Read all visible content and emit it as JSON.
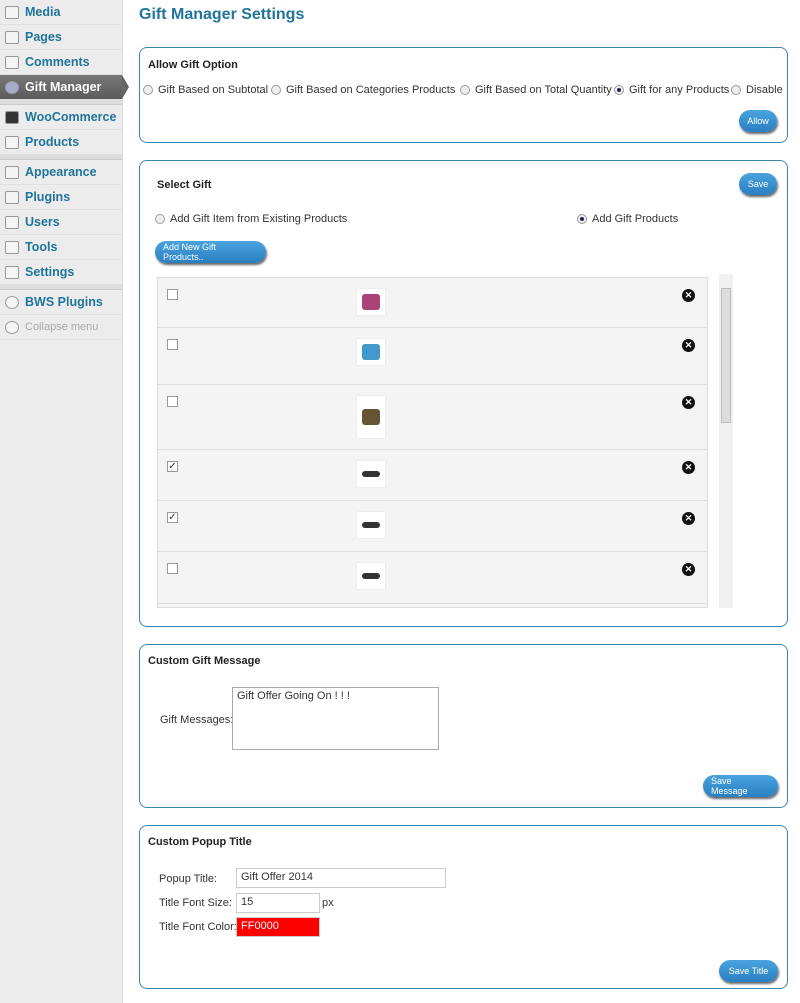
{
  "sidebar": {
    "items": [
      {
        "label": "Media",
        "icon": "media-icon"
      },
      {
        "label": "Pages",
        "icon": "pages-icon"
      },
      {
        "label": "Comments",
        "icon": "comments-icon"
      },
      {
        "label": "Gift Manager",
        "icon": "gear-icon",
        "active": true
      },
      {
        "label": "WooCommerce",
        "icon": "woocommerce-icon"
      },
      {
        "label": "Products",
        "icon": "cart-icon"
      },
      {
        "label": "Appearance",
        "icon": "appearance-icon"
      },
      {
        "label": "Plugins",
        "icon": "plugin-icon"
      },
      {
        "label": "Users",
        "icon": "users-icon"
      },
      {
        "label": "Tools",
        "icon": "tools-icon"
      },
      {
        "label": "Settings",
        "icon": "settings-icon"
      },
      {
        "label": "BWS Plugins",
        "icon": "bws-icon"
      },
      {
        "label": "Collapse menu",
        "icon": "collapse-icon"
      }
    ]
  },
  "page_title": "Gift Manager Settings",
  "allow": {
    "title": "Allow Gift Option",
    "options": [
      "Gift Based on Subtotal",
      "Gift Based on Categories Products",
      "Gift Based on Total Quantity",
      "Gift for any Products",
      "Disable"
    ],
    "selected": "Gift for any Products",
    "button": "Allow"
  },
  "select_gift": {
    "title": "Select Gift",
    "save": "Save",
    "options": [
      "Add Gift Item from Existing Products",
      "Add Gift Products"
    ],
    "selected": "Add Gift Products",
    "add_button": "Add New Gift Products..",
    "items": [
      {
        "checked": false,
        "image": "perfume"
      },
      {
        "checked": false,
        "image": "cologne"
      },
      {
        "checked": false,
        "image": "perfume-bottle"
      },
      {
        "checked": true,
        "image": "sunglasses"
      },
      {
        "checked": true,
        "image": "sunglasses"
      },
      {
        "checked": false,
        "image": "sunglasses"
      }
    ]
  },
  "message": {
    "title": "Custom Gift Message",
    "label": "Gift Messages:",
    "value": "Gift Offer Going On ! ! !",
    "button": "Save Message"
  },
  "popup": {
    "title": "Custom Popup Title",
    "title_label": "Popup Title:",
    "title_value": "Gift Offer 2014",
    "size_label": "Title Font Size:",
    "size_value": "15",
    "size_unit": "px",
    "color_label": "Title Font Color:",
    "color_value": "FF0000",
    "color_hex": "#FF0000",
    "button": "Save Title"
  },
  "colors": {
    "accent": "#21759b",
    "button": "#2a7fc0"
  }
}
